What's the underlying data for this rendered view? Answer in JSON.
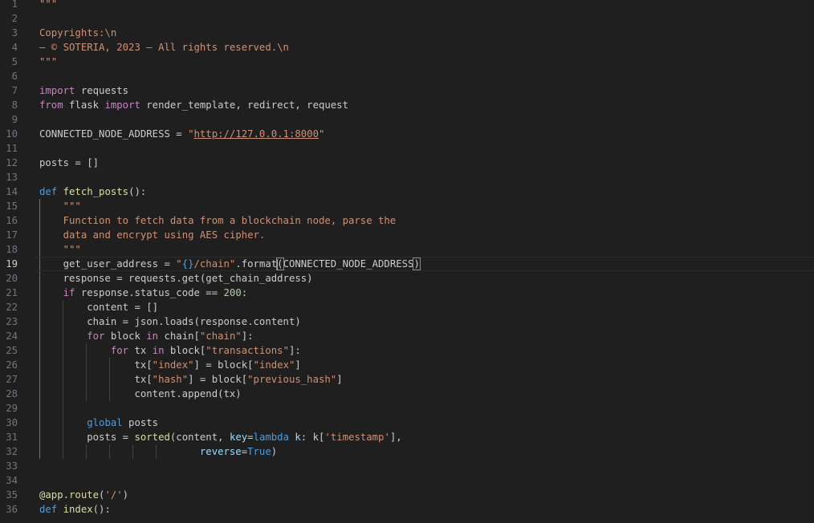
{
  "editor": {
    "current_line": 19,
    "lines": [
      [
        {
          "t": "str",
          "v": "\"\"\""
        }
      ],
      [],
      [
        {
          "t": "str",
          "v": "Copyrights:\\n"
        }
      ],
      [
        {
          "t": "str",
          "v": "– © SOTERIA, 2023 – All rights reserved.\\n"
        }
      ],
      [
        {
          "t": "str",
          "v": "\"\"\""
        }
      ],
      [],
      [
        {
          "t": "kw",
          "v": "import"
        },
        {
          "t": "plain",
          "v": " requests"
        }
      ],
      [
        {
          "t": "kw",
          "v": "from"
        },
        {
          "t": "plain",
          "v": " flask "
        },
        {
          "t": "kw",
          "v": "import"
        },
        {
          "t": "plain",
          "v": " render_template, redirect, request"
        }
      ],
      [],
      [
        {
          "t": "plain",
          "v": "CONNECTED_NODE_ADDRESS = "
        },
        {
          "t": "str",
          "v": "\""
        },
        {
          "t": "link",
          "v": "http://127.0.0.1:8000"
        },
        {
          "t": "str",
          "v": "\""
        }
      ],
      [],
      [
        {
          "t": "plain",
          "v": "posts = []"
        }
      ],
      [],
      [
        {
          "t": "def",
          "v": "def"
        },
        {
          "t": "plain",
          "v": " "
        },
        {
          "t": "fn",
          "v": "fetch_posts"
        },
        {
          "t": "plain",
          "v": "():"
        }
      ],
      [
        {
          "t": "plain",
          "v": "    "
        },
        {
          "t": "str",
          "v": "\"\"\""
        }
      ],
      [
        {
          "t": "plain",
          "v": "    "
        },
        {
          "t": "str",
          "v": "Function to fetch data from a blockchain node, parse the"
        }
      ],
      [
        {
          "t": "plain",
          "v": "    "
        },
        {
          "t": "str",
          "v": "data and encrypt using AES cipher."
        }
      ],
      [
        {
          "t": "plain",
          "v": "    "
        },
        {
          "t": "str",
          "v": "\"\"\""
        }
      ],
      [
        {
          "t": "plain",
          "v": "    get_user_address = "
        },
        {
          "t": "str",
          "v": "\""
        },
        {
          "t": "def",
          "v": "{}"
        },
        {
          "t": "str",
          "v": "/chain\""
        },
        {
          "t": "plain",
          "v": ".format"
        },
        {
          "t": "cursor",
          "v": ""
        },
        {
          "t": "match",
          "v": "("
        },
        {
          "t": "plain",
          "v": "CONNECTED_NODE_ADDRESS"
        },
        {
          "t": "match",
          "v": ")"
        }
      ],
      [
        {
          "t": "plain",
          "v": "    response = requests.get(get_chain_address)"
        }
      ],
      [
        {
          "t": "plain",
          "v": "    "
        },
        {
          "t": "kw",
          "v": "if"
        },
        {
          "t": "plain",
          "v": " response.status_code == "
        },
        {
          "t": "num",
          "v": "200"
        },
        {
          "t": "plain",
          "v": ":"
        }
      ],
      [
        {
          "t": "plain",
          "v": "        content = []"
        }
      ],
      [
        {
          "t": "plain",
          "v": "        chain = json.loads(response.content)"
        }
      ],
      [
        {
          "t": "plain",
          "v": "        "
        },
        {
          "t": "kw",
          "v": "for"
        },
        {
          "t": "plain",
          "v": " block "
        },
        {
          "t": "kw",
          "v": "in"
        },
        {
          "t": "plain",
          "v": " chain["
        },
        {
          "t": "str",
          "v": "\"chain\""
        },
        {
          "t": "plain",
          "v": "]:"
        }
      ],
      [
        {
          "t": "plain",
          "v": "            "
        },
        {
          "t": "kw",
          "v": "for"
        },
        {
          "t": "plain",
          "v": " tx "
        },
        {
          "t": "kw",
          "v": "in"
        },
        {
          "t": "plain",
          "v": " block["
        },
        {
          "t": "str",
          "v": "\"transactions\""
        },
        {
          "t": "plain",
          "v": "]:"
        }
      ],
      [
        {
          "t": "plain",
          "v": "                tx["
        },
        {
          "t": "str",
          "v": "\"index\""
        },
        {
          "t": "plain",
          "v": "] = block["
        },
        {
          "t": "str",
          "v": "\"index\""
        },
        {
          "t": "plain",
          "v": "]"
        }
      ],
      [
        {
          "t": "plain",
          "v": "                tx["
        },
        {
          "t": "str",
          "v": "\"hash\""
        },
        {
          "t": "plain",
          "v": "] = block["
        },
        {
          "t": "str",
          "v": "\"previous_hash\""
        },
        {
          "t": "plain",
          "v": "]"
        }
      ],
      [
        {
          "t": "plain",
          "v": "                content.append(tx)"
        }
      ],
      [],
      [
        {
          "t": "plain",
          "v": "        "
        },
        {
          "t": "def",
          "v": "global"
        },
        {
          "t": "plain",
          "v": " posts"
        }
      ],
      [
        {
          "t": "plain",
          "v": "        posts = "
        },
        {
          "t": "fn",
          "v": "sorted"
        },
        {
          "t": "plain",
          "v": "(content, "
        },
        {
          "t": "var",
          "v": "key"
        },
        {
          "t": "plain",
          "v": "="
        },
        {
          "t": "def",
          "v": "lambda"
        },
        {
          "t": "plain",
          "v": " "
        },
        {
          "t": "var",
          "v": "k"
        },
        {
          "t": "plain",
          "v": ": k["
        },
        {
          "t": "str",
          "v": "'timestamp'"
        },
        {
          "t": "plain",
          "v": "],"
        }
      ],
      [
        {
          "t": "plain",
          "v": "                           "
        },
        {
          "t": "var",
          "v": "reverse"
        },
        {
          "t": "plain",
          "v": "="
        },
        {
          "t": "def",
          "v": "True"
        },
        {
          "t": "plain",
          "v": ")"
        }
      ],
      [],
      [],
      [
        {
          "t": "fn",
          "v": "@app.route"
        },
        {
          "t": "plain",
          "v": "("
        },
        {
          "t": "str",
          "v": "'/'"
        },
        {
          "t": "plain",
          "v": ")"
        }
      ],
      [
        {
          "t": "def",
          "v": "def"
        },
        {
          "t": "plain",
          "v": " "
        },
        {
          "t": "fn",
          "v": "index"
        },
        {
          "t": "plain",
          "v": "():"
        }
      ]
    ],
    "indent_guides": {
      "15": [
        0
      ],
      "16": [
        0
      ],
      "17": [
        0
      ],
      "18": [
        0
      ],
      "19": [
        0
      ],
      "20": [
        0
      ],
      "21": [
        0
      ],
      "22": [
        0,
        1
      ],
      "23": [
        0,
        1
      ],
      "24": [
        0,
        1
      ],
      "25": [
        0,
        1,
        2
      ],
      "26": [
        0,
        1,
        2,
        3
      ],
      "27": [
        0,
        1,
        2,
        3
      ],
      "28": [
        0,
        1,
        2,
        3
      ],
      "29": [
        0,
        1
      ],
      "30": [
        0,
        1
      ],
      "31": [
        0,
        1
      ],
      "32": [
        0,
        1,
        2,
        3,
        4,
        5
      ]
    }
  }
}
